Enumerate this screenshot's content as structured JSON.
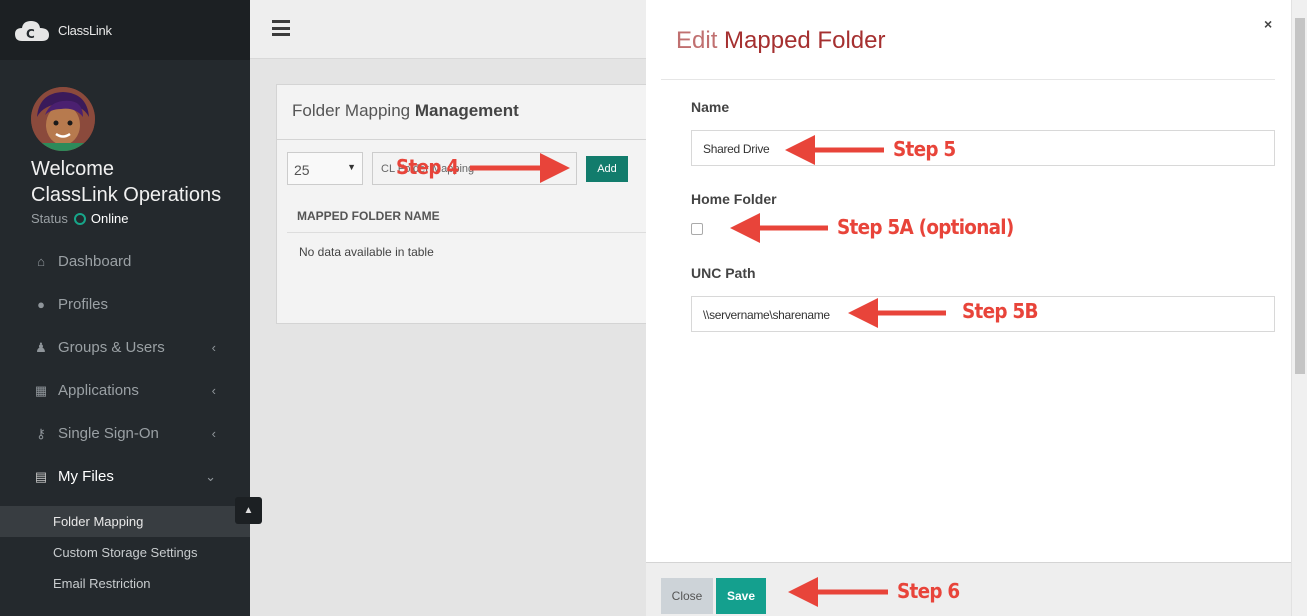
{
  "app": {
    "brand": "ClassLink"
  },
  "user": {
    "welcome": "Welcome",
    "name": "ClassLink Operations",
    "status_label": "Status",
    "status_value": "Online"
  },
  "nav": [
    {
      "label": "Dashboard",
      "icon": "home-icon",
      "glyph": "⌂",
      "chevron": ""
    },
    {
      "label": "Profiles",
      "icon": "user-icon",
      "glyph": "●",
      "chevron": ""
    },
    {
      "label": "Groups & Users",
      "icon": "users-icon",
      "glyph": "♟",
      "chevron": "‹"
    },
    {
      "label": "Applications",
      "icon": "grid-icon",
      "glyph": "▦",
      "chevron": "‹"
    },
    {
      "label": "Single Sign-On",
      "icon": "key-icon",
      "glyph": "⚷",
      "chevron": "‹"
    },
    {
      "label": "My Files",
      "icon": "file-icon",
      "glyph": "▤",
      "chevron": "⌄"
    }
  ],
  "subnav": [
    {
      "label": "Folder Mapping"
    },
    {
      "label": "Custom Storage Settings"
    },
    {
      "label": "Email Restriction"
    }
  ],
  "panel": {
    "title_light": "Folder Mapping",
    "title_bold": "Management",
    "page_length": "25",
    "filter_text": "CL Folder Mapping",
    "add_label": "Add",
    "column_header": "MAPPED FOLDER NAME",
    "empty_text": "No data available in table"
  },
  "modal": {
    "title_light": "Edit",
    "title_bold": "Mapped Folder",
    "close_glyph": "×",
    "name_label": "Name",
    "name_value": "Shared Drive",
    "home_folder_label": "Home Folder",
    "home_folder_checked": false,
    "unc_label": "UNC Path",
    "unc_value": "\\\\servername\\sharename",
    "close_button": "Close",
    "save_button": "Save"
  },
  "annotations": {
    "step4": "Step 4",
    "step5": "Step 5",
    "step5a": "Step 5A (optional)",
    "step5b": "Step 5B",
    "step6": "Step 6"
  },
  "colors": {
    "sidebar_bg": "#24292d",
    "accent_teal": "#14a08e",
    "title_red": "#a53030",
    "annotation_red": "#e8443a",
    "status_green": "#17a589"
  }
}
